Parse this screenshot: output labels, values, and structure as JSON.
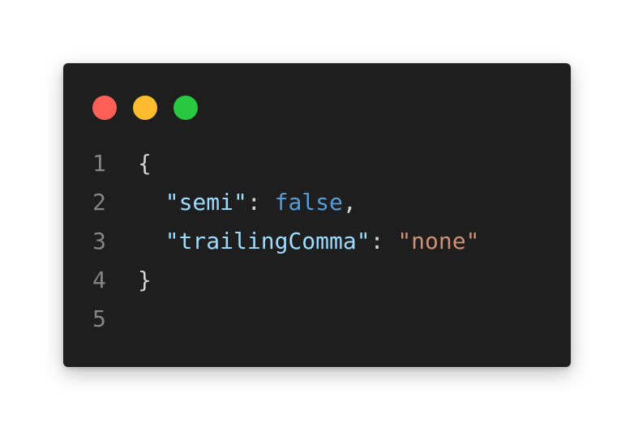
{
  "window": {
    "controls": [
      {
        "name": "close",
        "color": "#ff5f57"
      },
      {
        "name": "minimize",
        "color": "#febc2e"
      },
      {
        "name": "maximize",
        "color": "#28c840"
      }
    ]
  },
  "code": {
    "language": "json",
    "lines": [
      {
        "number": "1",
        "open_brace": "{"
      },
      {
        "number": "2",
        "indent": "  ",
        "key": "\"semi\"",
        "colon": ": ",
        "value": "false",
        "comma": ","
      },
      {
        "number": "3",
        "indent": "  ",
        "key": "\"trailingComma\"",
        "colon": ": ",
        "value": "\"none\""
      },
      {
        "number": "4",
        "close_brace": "}"
      },
      {
        "number": "5"
      }
    ]
  },
  "colors": {
    "background": "#1e1e1e",
    "line_number": "#858585",
    "punctuation": "#d4d4d4",
    "key": "#9cdcfe",
    "keyword": "#569cd6",
    "string": "#ce9178"
  }
}
